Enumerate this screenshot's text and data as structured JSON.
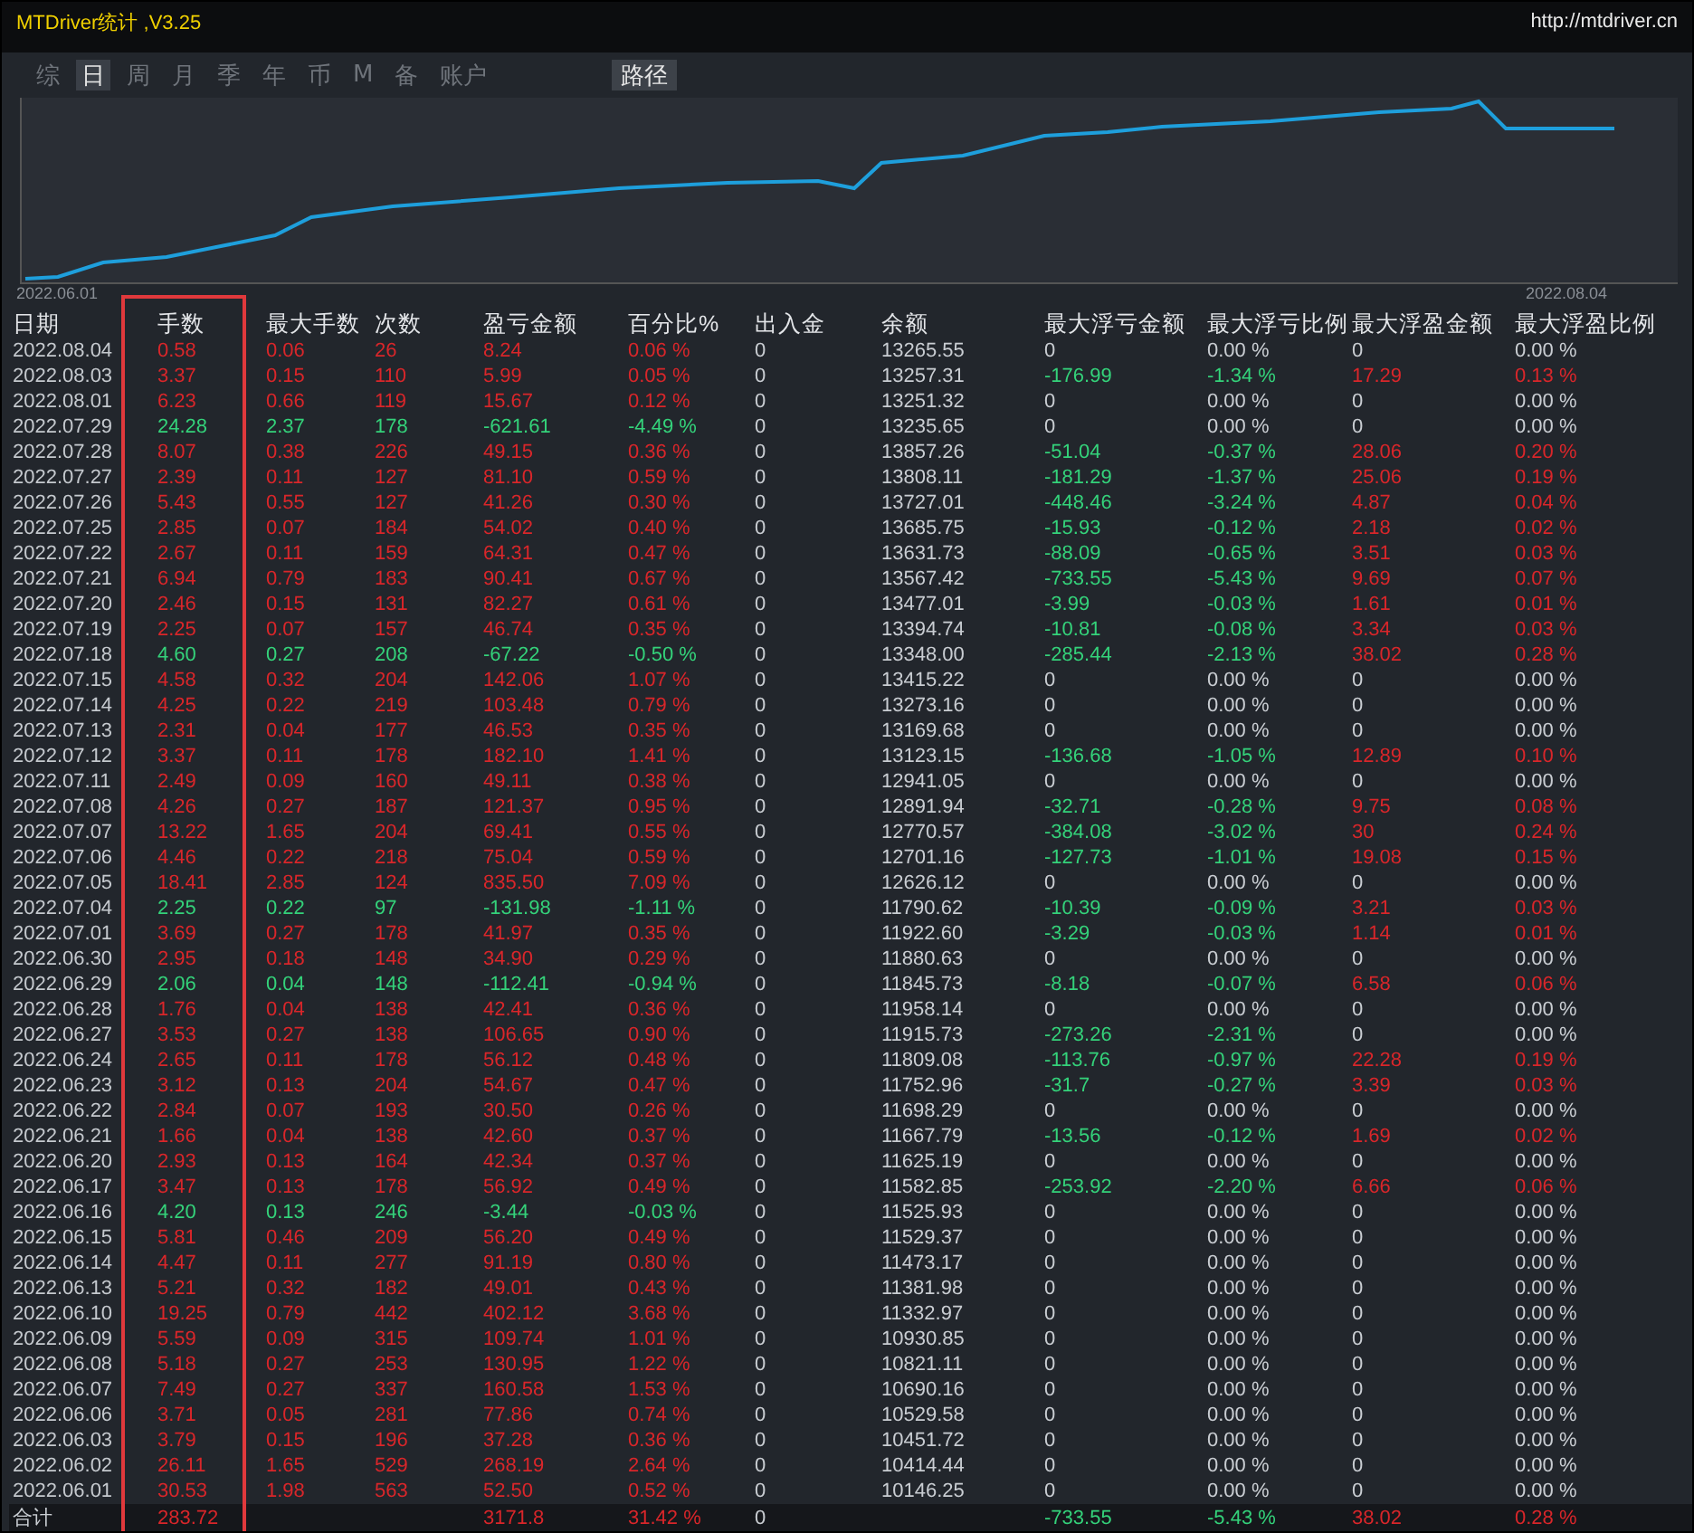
{
  "window": {
    "title": "MTDriver统计 ,V3.25",
    "link": "http://mtdriver.cn"
  },
  "tabs": [
    {
      "label": "综",
      "selected": false
    },
    {
      "label": "日",
      "selected": true
    },
    {
      "label": "周",
      "selected": false
    },
    {
      "label": "月",
      "selected": false
    },
    {
      "label": "季",
      "selected": false
    },
    {
      "label": "年",
      "selected": false
    },
    {
      "label": "币",
      "selected": false
    },
    {
      "label": "M",
      "selected": false
    },
    {
      "label": "备",
      "selected": false
    },
    {
      "label": "账户",
      "selected": false
    }
  ],
  "path_button": "路径",
  "chart": {
    "start_label": "2022.06.01",
    "end_label": "2022.08.04"
  },
  "table": {
    "columns": [
      {
        "label": "日期",
        "highlighted": false
      },
      {
        "label": "手数",
        "highlighted": true
      },
      {
        "label": "最大手数",
        "highlighted": false
      },
      {
        "label": "次数",
        "highlighted": false
      },
      {
        "label": "盈亏金额",
        "highlighted": false
      },
      {
        "label": "百分比%",
        "highlighted": false
      },
      {
        "label": "出入金",
        "highlighted": false
      },
      {
        "label": "余额",
        "highlighted": false
      },
      {
        "label": "最大浮亏金额",
        "highlighted": false
      },
      {
        "label": "最大浮亏比例",
        "highlighted": false
      },
      {
        "label": "最大浮盈金额",
        "highlighted": false
      },
      {
        "label": "最大浮盈比例",
        "highlighted": false
      }
    ],
    "rows": [
      {
        "cells": [
          "2022.08.04",
          "0.58",
          "0.06",
          "26",
          "8.24",
          "0.06 %",
          "0",
          "13265.55",
          "0",
          "0.00 %",
          "0",
          "0.00 %"
        ],
        "loss": false,
        "float_loss": false,
        "float_profit": false
      },
      {
        "cells": [
          "2022.08.03",
          "3.37",
          "0.15",
          "110",
          "5.99",
          "0.05 %",
          "0",
          "13257.31",
          "-176.99",
          "-1.34 %",
          "17.29",
          "0.13 %"
        ],
        "loss": false,
        "float_loss": true,
        "float_profit": true
      },
      {
        "cells": [
          "2022.08.01",
          "6.23",
          "0.66",
          "119",
          "15.67",
          "0.12 %",
          "0",
          "13251.32",
          "0",
          "0.00 %",
          "0",
          "0.00 %"
        ],
        "loss": false,
        "float_loss": false,
        "float_profit": false
      },
      {
        "cells": [
          "2022.07.29",
          "24.28",
          "2.37",
          "178",
          "-621.61",
          "-4.49 %",
          "0",
          "13235.65",
          "0",
          "0.00 %",
          "0",
          "0.00 %"
        ],
        "loss": true,
        "float_loss": false,
        "float_profit": false
      },
      {
        "cells": [
          "2022.07.28",
          "8.07",
          "0.38",
          "226",
          "49.15",
          "0.36 %",
          "0",
          "13857.26",
          "-51.04",
          "-0.37 %",
          "28.06",
          "0.20 %"
        ],
        "loss": false,
        "float_loss": true,
        "float_profit": true
      },
      {
        "cells": [
          "2022.07.27",
          "2.39",
          "0.11",
          "127",
          "81.10",
          "0.59 %",
          "0",
          "13808.11",
          "-181.29",
          "-1.37 %",
          "25.06",
          "0.19 %"
        ],
        "loss": false,
        "float_loss": true,
        "float_profit": true
      },
      {
        "cells": [
          "2022.07.26",
          "5.43",
          "0.55",
          "127",
          "41.26",
          "0.30 %",
          "0",
          "13727.01",
          "-448.46",
          "-3.24 %",
          "4.87",
          "0.04 %"
        ],
        "loss": false,
        "float_loss": true,
        "float_profit": true
      },
      {
        "cells": [
          "2022.07.25",
          "2.85",
          "0.07",
          "184",
          "54.02",
          "0.40 %",
          "0",
          "13685.75",
          "-15.93",
          "-0.12 %",
          "2.18",
          "0.02 %"
        ],
        "loss": false,
        "float_loss": true,
        "float_profit": true
      },
      {
        "cells": [
          "2022.07.22",
          "2.67",
          "0.11",
          "159",
          "64.31",
          "0.47 %",
          "0",
          "13631.73",
          "-88.09",
          "-0.65 %",
          "3.51",
          "0.03 %"
        ],
        "loss": false,
        "float_loss": true,
        "float_profit": true
      },
      {
        "cells": [
          "2022.07.21",
          "6.94",
          "0.79",
          "183",
          "90.41",
          "0.67 %",
          "0",
          "13567.42",
          "-733.55",
          "-5.43 %",
          "9.69",
          "0.07 %"
        ],
        "loss": false,
        "float_loss": true,
        "float_profit": true
      },
      {
        "cells": [
          "2022.07.20",
          "2.46",
          "0.15",
          "131",
          "82.27",
          "0.61 %",
          "0",
          "13477.01",
          "-3.99",
          "-0.03 %",
          "1.61",
          "0.01 %"
        ],
        "loss": false,
        "float_loss": true,
        "float_profit": true
      },
      {
        "cells": [
          "2022.07.19",
          "2.25",
          "0.07",
          "157",
          "46.74",
          "0.35 %",
          "0",
          "13394.74",
          "-10.81",
          "-0.08 %",
          "3.34",
          "0.03 %"
        ],
        "loss": false,
        "float_loss": true,
        "float_profit": true
      },
      {
        "cells": [
          "2022.07.18",
          "4.60",
          "0.27",
          "208",
          "-67.22",
          "-0.50 %",
          "0",
          "13348.00",
          "-285.44",
          "-2.13 %",
          "38.02",
          "0.28 %"
        ],
        "loss": true,
        "float_loss": true,
        "float_profit": true
      },
      {
        "cells": [
          "2022.07.15",
          "4.58",
          "0.32",
          "204",
          "142.06",
          "1.07 %",
          "0",
          "13415.22",
          "0",
          "0.00 %",
          "0",
          "0.00 %"
        ],
        "loss": false,
        "float_loss": false,
        "float_profit": false
      },
      {
        "cells": [
          "2022.07.14",
          "4.25",
          "0.22",
          "219",
          "103.48",
          "0.79 %",
          "0",
          "13273.16",
          "0",
          "0.00 %",
          "0",
          "0.00 %"
        ],
        "loss": false,
        "float_loss": false,
        "float_profit": false
      },
      {
        "cells": [
          "2022.07.13",
          "2.31",
          "0.04",
          "177",
          "46.53",
          "0.35 %",
          "0",
          "13169.68",
          "0",
          "0.00 %",
          "0",
          "0.00 %"
        ],
        "loss": false,
        "float_loss": false,
        "float_profit": false
      },
      {
        "cells": [
          "2022.07.12",
          "3.37",
          "0.11",
          "178",
          "182.10",
          "1.41 %",
          "0",
          "13123.15",
          "-136.68",
          "-1.05 %",
          "12.89",
          "0.10 %"
        ],
        "loss": false,
        "float_loss": true,
        "float_profit": true
      },
      {
        "cells": [
          "2022.07.11",
          "2.49",
          "0.09",
          "160",
          "49.11",
          "0.38 %",
          "0",
          "12941.05",
          "0",
          "0.00 %",
          "0",
          "0.00 %"
        ],
        "loss": false,
        "float_loss": false,
        "float_profit": false
      },
      {
        "cells": [
          "2022.07.08",
          "4.26",
          "0.27",
          "187",
          "121.37",
          "0.95 %",
          "0",
          "12891.94",
          "-32.71",
          "-0.28 %",
          "9.75",
          "0.08 %"
        ],
        "loss": false,
        "float_loss": true,
        "float_profit": true
      },
      {
        "cells": [
          "2022.07.07",
          "13.22",
          "1.65",
          "204",
          "69.41",
          "0.55 %",
          "0",
          "12770.57",
          "-384.08",
          "-3.02 %",
          "30",
          "0.24 %"
        ],
        "loss": false,
        "float_loss": true,
        "float_profit": true
      },
      {
        "cells": [
          "2022.07.06",
          "4.46",
          "0.22",
          "218",
          "75.04",
          "0.59 %",
          "0",
          "12701.16",
          "-127.73",
          "-1.01 %",
          "19.08",
          "0.15 %"
        ],
        "loss": false,
        "float_loss": true,
        "float_profit": true
      },
      {
        "cells": [
          "2022.07.05",
          "18.41",
          "2.85",
          "124",
          "835.50",
          "7.09 %",
          "0",
          "12626.12",
          "0",
          "0.00 %",
          "0",
          "0.00 %"
        ],
        "loss": false,
        "float_loss": false,
        "float_profit": false
      },
      {
        "cells": [
          "2022.07.04",
          "2.25",
          "0.22",
          "97",
          "-131.98",
          "-1.11 %",
          "0",
          "11790.62",
          "-10.39",
          "-0.09 %",
          "3.21",
          "0.03 %"
        ],
        "loss": true,
        "float_loss": true,
        "float_profit": true
      },
      {
        "cells": [
          "2022.07.01",
          "3.69",
          "0.27",
          "178",
          "41.97",
          "0.35 %",
          "0",
          "11922.60",
          "-3.29",
          "-0.03 %",
          "1.14",
          "0.01 %"
        ],
        "loss": false,
        "float_loss": true,
        "float_profit": true
      },
      {
        "cells": [
          "2022.06.30",
          "2.95",
          "0.18",
          "148",
          "34.90",
          "0.29 %",
          "0",
          "11880.63",
          "0",
          "0.00 %",
          "0",
          "0.00 %"
        ],
        "loss": false,
        "float_loss": false,
        "float_profit": false
      },
      {
        "cells": [
          "2022.06.29",
          "2.06",
          "0.04",
          "148",
          "-112.41",
          "-0.94 %",
          "0",
          "11845.73",
          "-8.18",
          "-0.07 %",
          "6.58",
          "0.06 %"
        ],
        "loss": true,
        "float_loss": true,
        "float_profit": true
      },
      {
        "cells": [
          "2022.06.28",
          "1.76",
          "0.04",
          "138",
          "42.41",
          "0.36 %",
          "0",
          "11958.14",
          "0",
          "0.00 %",
          "0",
          "0.00 %"
        ],
        "loss": false,
        "float_loss": false,
        "float_profit": false
      },
      {
        "cells": [
          "2022.06.27",
          "3.53",
          "0.27",
          "138",
          "106.65",
          "0.90 %",
          "0",
          "11915.73",
          "-273.26",
          "-2.31 %",
          "0",
          "0.00 %"
        ],
        "loss": false,
        "float_loss": true,
        "float_profit": false
      },
      {
        "cells": [
          "2022.06.24",
          "2.65",
          "0.11",
          "178",
          "56.12",
          "0.48 %",
          "0",
          "11809.08",
          "-113.76",
          "-0.97 %",
          "22.28",
          "0.19 %"
        ],
        "loss": false,
        "float_loss": true,
        "float_profit": true
      },
      {
        "cells": [
          "2022.06.23",
          "3.12",
          "0.13",
          "204",
          "54.67",
          "0.47 %",
          "0",
          "11752.96",
          "-31.7",
          "-0.27 %",
          "3.39",
          "0.03 %"
        ],
        "loss": false,
        "float_loss": true,
        "float_profit": true
      },
      {
        "cells": [
          "2022.06.22",
          "2.84",
          "0.07",
          "193",
          "30.50",
          "0.26 %",
          "0",
          "11698.29",
          "0",
          "0.00 %",
          "0",
          "0.00 %"
        ],
        "loss": false,
        "float_loss": false,
        "float_profit": false
      },
      {
        "cells": [
          "2022.06.21",
          "1.66",
          "0.04",
          "138",
          "42.60",
          "0.37 %",
          "0",
          "11667.79",
          "-13.56",
          "-0.12 %",
          "1.69",
          "0.02 %"
        ],
        "loss": false,
        "float_loss": true,
        "float_profit": true
      },
      {
        "cells": [
          "2022.06.20",
          "2.93",
          "0.13",
          "164",
          "42.34",
          "0.37 %",
          "0",
          "11625.19",
          "0",
          "0.00 %",
          "0",
          "0.00 %"
        ],
        "loss": false,
        "float_loss": false,
        "float_profit": false
      },
      {
        "cells": [
          "2022.06.17",
          "3.47",
          "0.13",
          "178",
          "56.92",
          "0.49 %",
          "0",
          "11582.85",
          "-253.92",
          "-2.20 %",
          "6.66",
          "0.06 %"
        ],
        "loss": false,
        "float_loss": true,
        "float_profit": true
      },
      {
        "cells": [
          "2022.06.16",
          "4.20",
          "0.13",
          "246",
          "-3.44",
          "-0.03 %",
          "0",
          "11525.93",
          "0",
          "0.00 %",
          "0",
          "0.00 %"
        ],
        "loss": true,
        "float_loss": false,
        "float_profit": false
      },
      {
        "cells": [
          "2022.06.15",
          "5.81",
          "0.46",
          "209",
          "56.20",
          "0.49 %",
          "0",
          "11529.37",
          "0",
          "0.00 %",
          "0",
          "0.00 %"
        ],
        "loss": false,
        "float_loss": false,
        "float_profit": false
      },
      {
        "cells": [
          "2022.06.14",
          "4.47",
          "0.11",
          "277",
          "91.19",
          "0.80 %",
          "0",
          "11473.17",
          "0",
          "0.00 %",
          "0",
          "0.00 %"
        ],
        "loss": false,
        "float_loss": false,
        "float_profit": false
      },
      {
        "cells": [
          "2022.06.13",
          "5.21",
          "0.32",
          "182",
          "49.01",
          "0.43 %",
          "0",
          "11381.98",
          "0",
          "0.00 %",
          "0",
          "0.00 %"
        ],
        "loss": false,
        "float_loss": false,
        "float_profit": false
      },
      {
        "cells": [
          "2022.06.10",
          "19.25",
          "0.79",
          "442",
          "402.12",
          "3.68 %",
          "0",
          "11332.97",
          "0",
          "0.00 %",
          "0",
          "0.00 %"
        ],
        "loss": false,
        "float_loss": false,
        "float_profit": false
      },
      {
        "cells": [
          "2022.06.09",
          "5.59",
          "0.09",
          "315",
          "109.74",
          "1.01 %",
          "0",
          "10930.85",
          "0",
          "0.00 %",
          "0",
          "0.00 %"
        ],
        "loss": false,
        "float_loss": false,
        "float_profit": false
      },
      {
        "cells": [
          "2022.06.08",
          "5.18",
          "0.27",
          "253",
          "130.95",
          "1.22 %",
          "0",
          "10821.11",
          "0",
          "0.00 %",
          "0",
          "0.00 %"
        ],
        "loss": false,
        "float_loss": false,
        "float_profit": false
      },
      {
        "cells": [
          "2022.06.07",
          "7.49",
          "0.27",
          "337",
          "160.58",
          "1.53 %",
          "0",
          "10690.16",
          "0",
          "0.00 %",
          "0",
          "0.00 %"
        ],
        "loss": false,
        "float_loss": false,
        "float_profit": false
      },
      {
        "cells": [
          "2022.06.06",
          "3.71",
          "0.05",
          "281",
          "77.86",
          "0.74 %",
          "0",
          "10529.58",
          "0",
          "0.00 %",
          "0",
          "0.00 %"
        ],
        "loss": false,
        "float_loss": false,
        "float_profit": false
      },
      {
        "cells": [
          "2022.06.03",
          "3.79",
          "0.15",
          "196",
          "37.28",
          "0.36 %",
          "0",
          "10451.72",
          "0",
          "0.00 %",
          "0",
          "0.00 %"
        ],
        "loss": false,
        "float_loss": false,
        "float_profit": false
      },
      {
        "cells": [
          "2022.06.02",
          "26.11",
          "1.65",
          "529",
          "268.19",
          "2.64 %",
          "0",
          "10414.44",
          "0",
          "0.00 %",
          "0",
          "0.00 %"
        ],
        "loss": false,
        "float_loss": false,
        "float_profit": false
      },
      {
        "cells": [
          "2022.06.01",
          "30.53",
          "1.98",
          "563",
          "52.50",
          "0.52 %",
          "0",
          "10146.25",
          "0",
          "0.00 %",
          "0",
          "0.00 %"
        ],
        "loss": false,
        "float_loss": false,
        "float_profit": false
      }
    ],
    "total": {
      "label": "合计",
      "lots": "283.72",
      "pnl": "3171.8",
      "pct": "31.42 %",
      "deposit": "0",
      "max_float_loss": "-733.55",
      "max_float_loss_pct": "-5.43 %",
      "max_float_profit": "38.02",
      "max_float_profit_pct": "0.28 %"
    }
  }
}
